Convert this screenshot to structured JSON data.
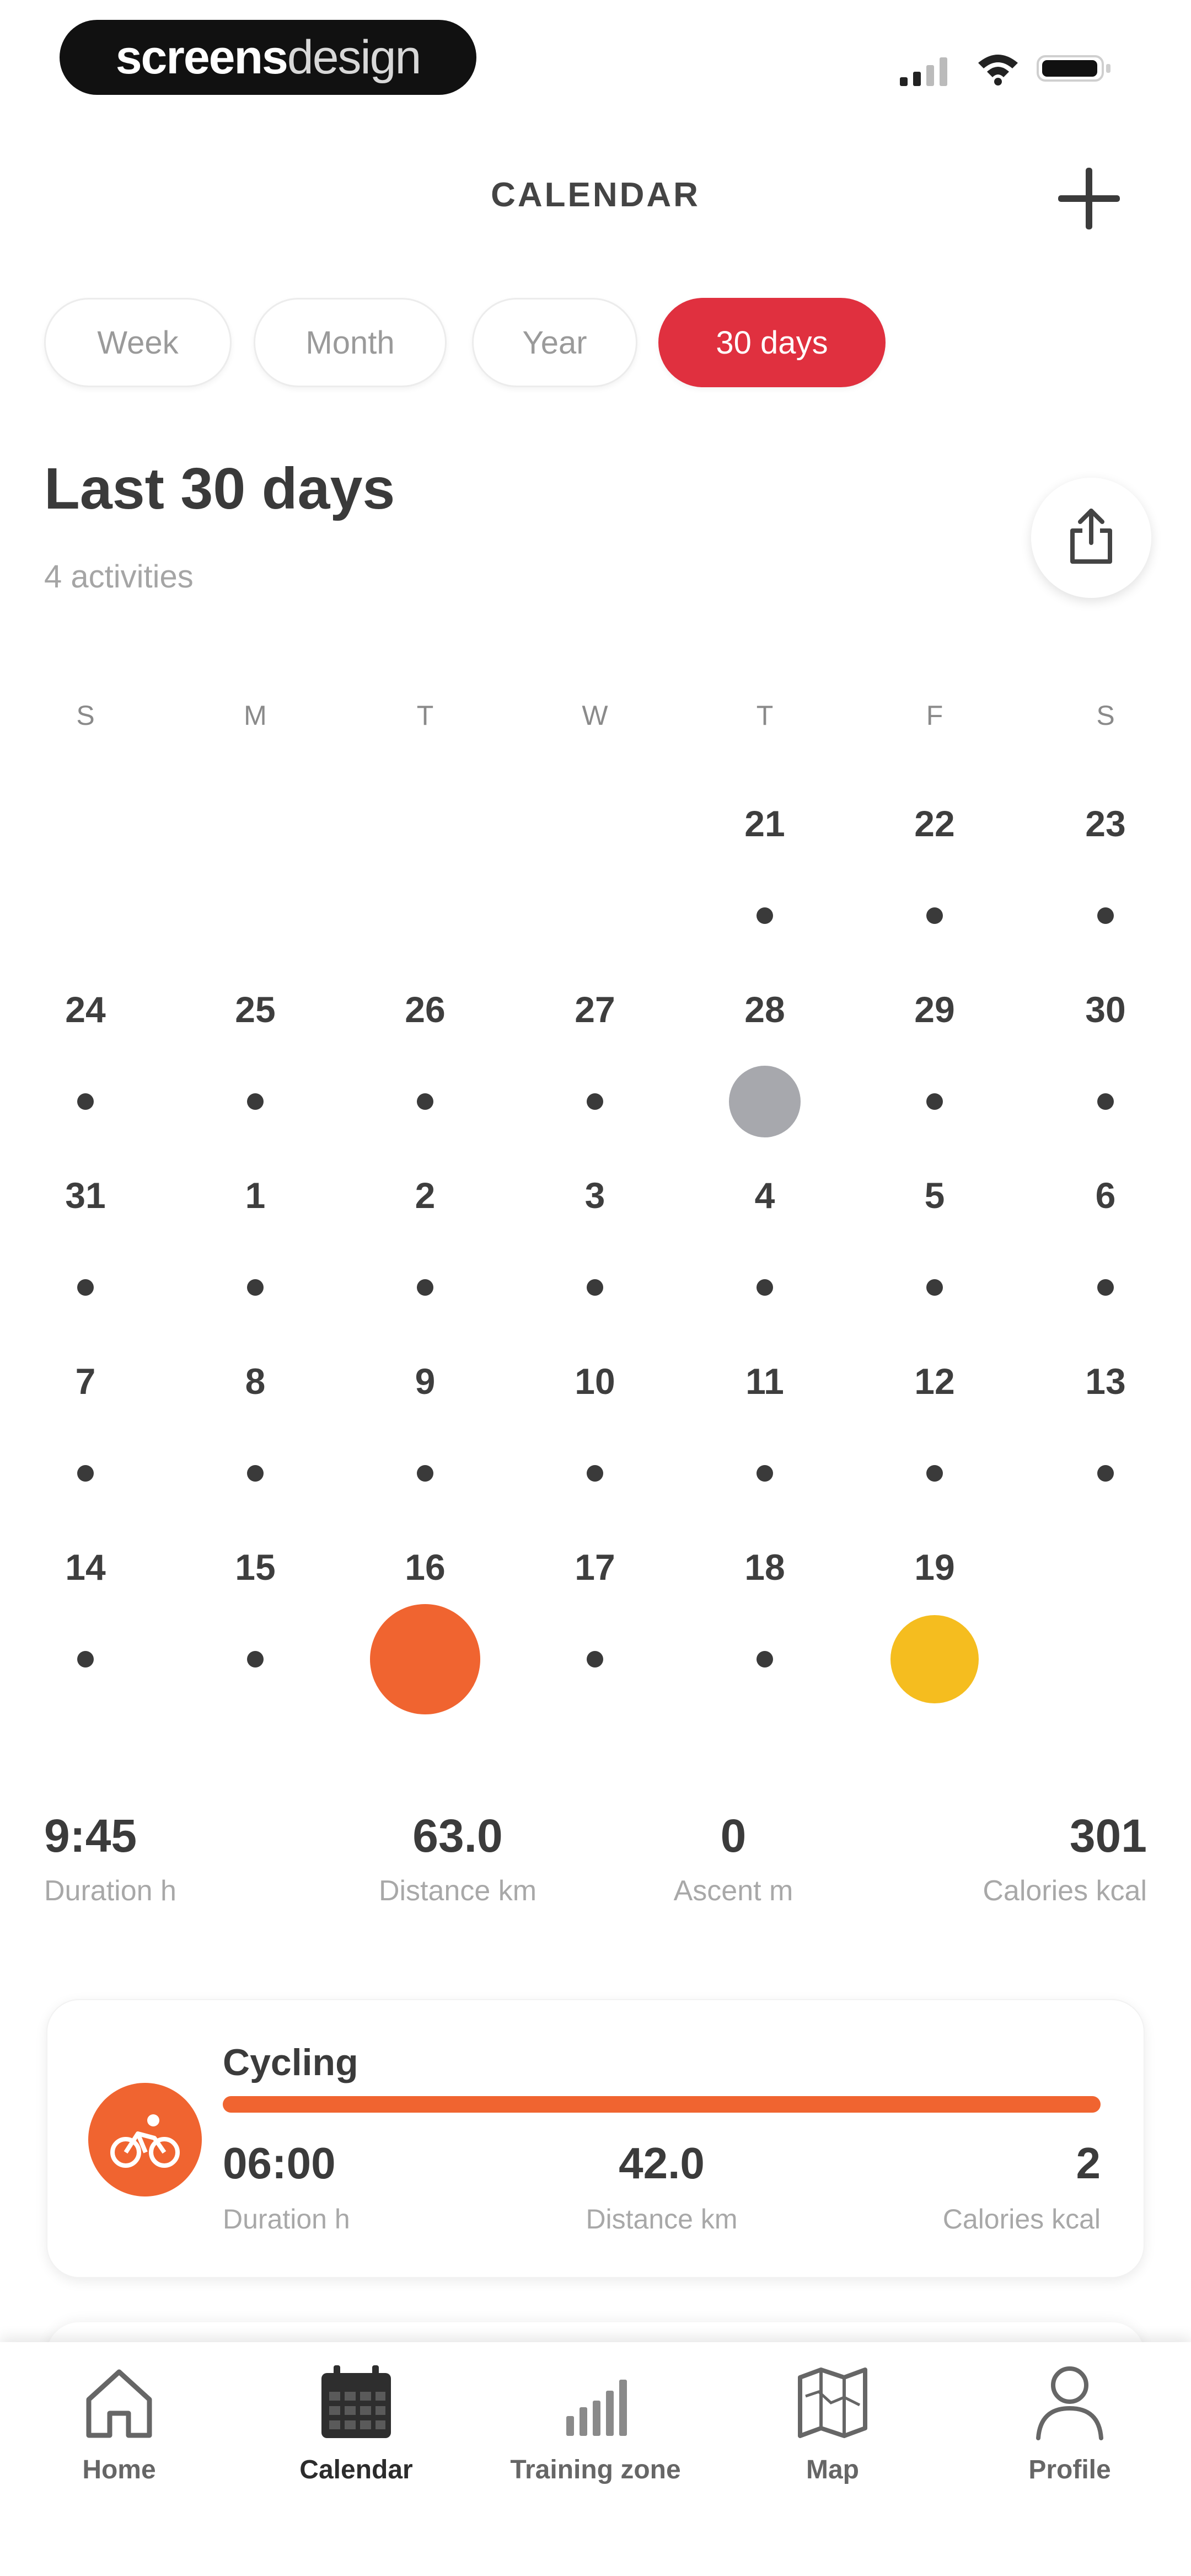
{
  "status": {
    "brand_bold": "screens",
    "brand_light": "design"
  },
  "header": {
    "title": "CALENDAR"
  },
  "tabs": [
    {
      "label": "Week",
      "active": false
    },
    {
      "label": "Month",
      "active": false
    },
    {
      "label": "Year",
      "active": false
    },
    {
      "label": "30 days",
      "active": true
    }
  ],
  "summary": {
    "title": "Last 30 days",
    "subtitle": "4 activities"
  },
  "calendar": {
    "weekdays": [
      "S",
      "M",
      "T",
      "W",
      "T",
      "F",
      "S"
    ],
    "weeks": [
      [
        "",
        "",
        "",
        "",
        "21",
        "22",
        "23"
      ],
      [
        "24",
        "25",
        "26",
        "27",
        "28",
        "29",
        "30"
      ],
      [
        "31",
        "1",
        "2",
        "3",
        "4",
        "5",
        "6"
      ],
      [
        "7",
        "8",
        "9",
        "10",
        "11",
        "12",
        "13"
      ],
      [
        "14",
        "15",
        "16",
        "17",
        "18",
        "19",
        ""
      ]
    ],
    "highlights": [
      {
        "day": "28",
        "color": "#a7a8ad"
      },
      {
        "day": "16",
        "color": "#f06430"
      },
      {
        "day": "19",
        "color": "#f5bd1f"
      }
    ]
  },
  "stats": {
    "duration": {
      "value": "9:45",
      "label": "Duration h"
    },
    "distance": {
      "value": "63.0",
      "label": "Distance km"
    },
    "ascent": {
      "value": "0",
      "label": "Ascent m"
    },
    "calories": {
      "value": "301",
      "label": "Calories kcal"
    }
  },
  "activity": {
    "name": "Cycling",
    "color": "#f06430",
    "duration": {
      "value": "06:00",
      "label": "Duration h"
    },
    "distance": {
      "value": "42.0",
      "label": "Distance km"
    },
    "calories": {
      "value": "2",
      "label": "Calories kcal"
    }
  },
  "nav": {
    "home": "Home",
    "calendar": "Calendar",
    "training": "Training zone",
    "map": "Map",
    "profile": "Profile"
  },
  "colors": {
    "accent": "#e0303f",
    "activity": "#f06430"
  }
}
